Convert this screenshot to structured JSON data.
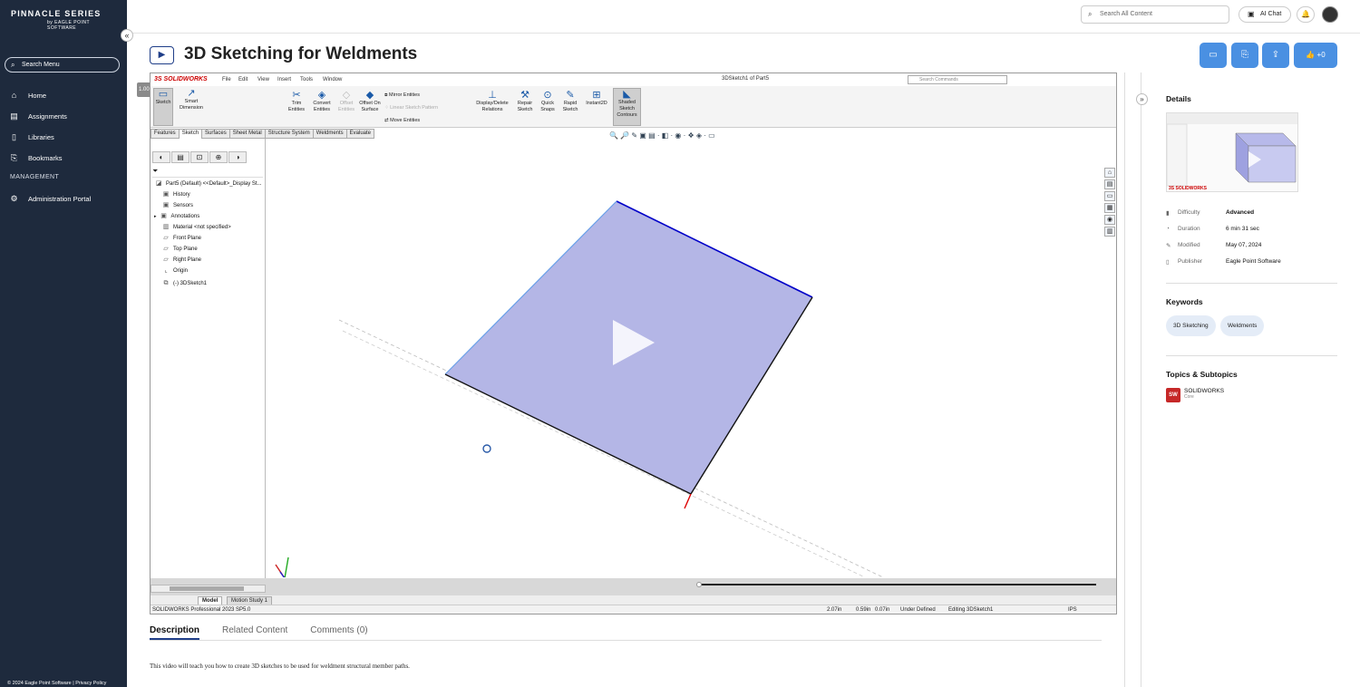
{
  "brand": {
    "title": "PINNACLE SERIES",
    "by": "by",
    "sub": "EAGLE POINT SOFTWARE"
  },
  "sidebar": {
    "search_label": "Search Menu",
    "items": [
      {
        "label": "Home",
        "icon": "home-icon"
      },
      {
        "label": "Assignments",
        "icon": "assignments-icon"
      },
      {
        "label": "Libraries",
        "icon": "book-icon"
      },
      {
        "label": "Bookmarks",
        "icon": "bookmark-icon"
      }
    ],
    "section": "MANAGEMENT",
    "admin_label": "Administration Portal",
    "footer": "© 2024 Eagle Point Software | Privacy Policy"
  },
  "topbar": {
    "search_placeholder": "Search All Content",
    "ai_chat": "AI Chat"
  },
  "page": {
    "title": "3D Sketching for Weldments",
    "like_label": "+0"
  },
  "video": {
    "badge": "1.00",
    "logo": "3S SOLIDWORKS",
    "menus": [
      "File",
      "Edit",
      "View",
      "Insert",
      "Tools",
      "Window"
    ],
    "doc_title": "3DSketch1 of Part5",
    "search_commands": "Search Commands",
    "ribbon": {
      "sketch": "Sketch",
      "smart_dim": "Smart Dimension",
      "trim": "Trim Entities",
      "convert": "Convert Entities",
      "offset": "Offset Entities",
      "offset_surface": "Offset On Surface",
      "mirror": "Mirror Entities",
      "linear": "Linear Sketch Pattern",
      "move": "Move Entities",
      "display": "Display/Delete Relations",
      "repair": "Repair Sketch",
      "quick": "Quick Snaps",
      "rapid": "Rapid Sketch",
      "instant": "Instant2D",
      "shaded": "Shaded Sketch Contours"
    },
    "tabs": [
      "Features",
      "Sketch",
      "Surfaces",
      "Sheet Metal",
      "Structure System",
      "Weldments",
      "Evaluate"
    ],
    "tree": [
      "Part5 (Default) <<Default>_Display St...",
      "History",
      "Sensors",
      "Annotations",
      "Material <not specified>",
      "Front Plane",
      "Top Plane",
      "Right Plane",
      "Origin",
      "(-) 3DSketch1"
    ],
    "bottom_tabs": [
      "Model",
      "Motion Study 1"
    ],
    "status": {
      "product": "SOLIDWORKS Professional 2023 SP5.0",
      "x": "2.07in",
      "y": "0.59in",
      "z": "0.07in",
      "state": "Under Defined",
      "editing": "Editing 3DSketch1",
      "units": "IPS"
    }
  },
  "content_tabs": {
    "description": "Description",
    "related": "Related Content",
    "comments": "Comments (0)"
  },
  "description": "This video will teach you how to create 3D sketches to be used for weldment structural member paths.",
  "details": {
    "heading": "Details",
    "thumb_logo": "3S SOLIDWORKS",
    "rows": [
      {
        "key": "Difficulty",
        "value": "Advanced",
        "icon": "bar-chart-icon"
      },
      {
        "key": "Duration",
        "value": "6 min 31 sec",
        "icon": "clock-icon"
      },
      {
        "key": "Modified",
        "value": "May 07, 2024",
        "icon": "pencil-icon"
      },
      {
        "key": "Publisher",
        "value": "Eagle Point Software",
        "icon": "book-icon"
      }
    ]
  },
  "keywords": {
    "heading": "Keywords",
    "items": [
      "3D Sketching",
      "Weldments"
    ]
  },
  "topics": {
    "heading": "Topics & Subtopics",
    "name": "SOLIDWORKS",
    "sub": "Core",
    "badge": "SW"
  },
  "colors": {
    "sidebar": "#1e2a3d",
    "accent": "#4a90e2",
    "sketch_fill": "#b4b6e6",
    "sketch_edge": "#0000c8"
  }
}
